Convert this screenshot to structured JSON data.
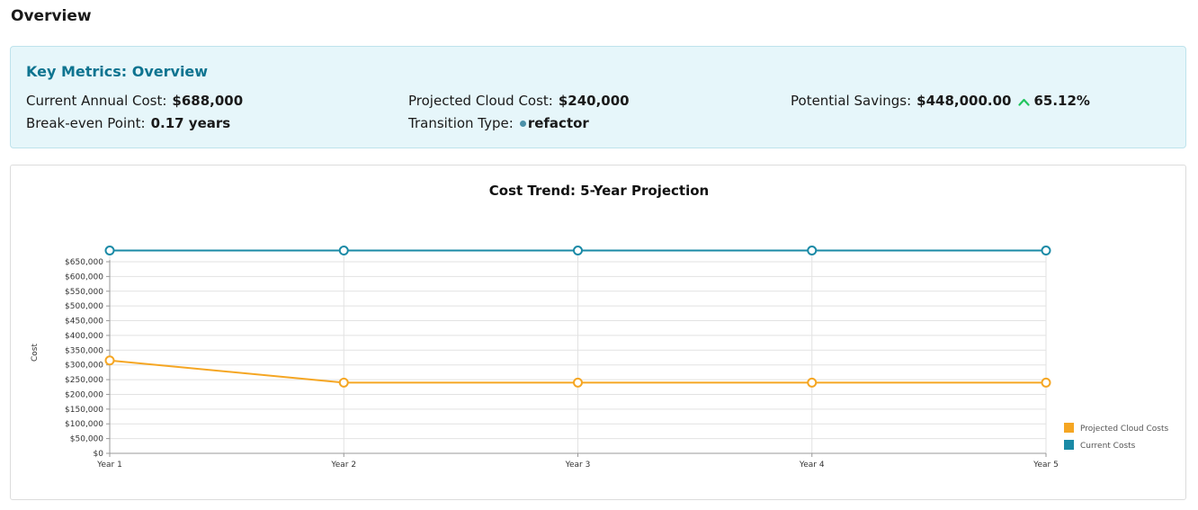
{
  "page": {
    "title": "Overview"
  },
  "metrics": {
    "title": "Key Metrics: Overview",
    "current_annual_cost": {
      "label": "Current Annual Cost:",
      "value": "$688,000"
    },
    "projected_cloud_cost": {
      "label": "Projected Cloud Cost:",
      "value": "$240,000"
    },
    "potential_savings": {
      "label": "Potential Savings:",
      "value": "$448,000.00",
      "percent": "65.12%",
      "trend_icon": "chevron-up-icon",
      "trend_color": "#22c55e"
    },
    "break_even": {
      "label": "Break-even Point:",
      "value": "0.17 years"
    },
    "transition_type": {
      "label": "Transition Type:",
      "value": "refactor",
      "dot_color": "#4a90a8"
    }
  },
  "chart_data": {
    "type": "line",
    "title": "Cost Trend: 5-Year Projection",
    "xlabel": "",
    "ylabel": "Cost",
    "categories": [
      "Year 1",
      "Year 2",
      "Year 3",
      "Year 4",
      "Year 5"
    ],
    "ylim": [
      0,
      650000
    ],
    "yticks": [
      "$0",
      "$50,000",
      "$100,000",
      "$150,000",
      "$200,000",
      "$250,000",
      "$300,000",
      "$350,000",
      "$400,000",
      "$450,000",
      "$500,000",
      "$550,000",
      "$600,000",
      "$650,000"
    ],
    "grid": true,
    "legend_position": "bottom-right",
    "series": [
      {
        "name": "Projected Cloud Costs",
        "color": "#f5a623",
        "values": [
          315000,
          240000,
          240000,
          240000,
          240000
        ]
      },
      {
        "name": "Current Costs",
        "color": "#1a8aa6",
        "values": [
          688000,
          688000,
          688000,
          688000,
          688000
        ]
      }
    ]
  }
}
